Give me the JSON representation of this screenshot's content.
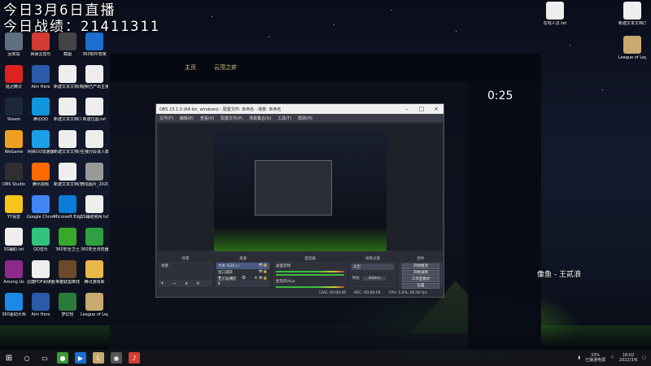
{
  "overlay": {
    "line1": "今日3月6日直播",
    "line2": "今日战绩：21411311",
    "streamer": "像鱼 - 王贰浪"
  },
  "desktop_left": [
    {
      "label": "回收站",
      "icon": "recycle-bin-icon",
      "color": "#607080"
    },
    {
      "label": "网易云音乐",
      "icon": "netease-music-icon",
      "color": "#d43c33"
    },
    {
      "label": "截图",
      "icon": "screenshot-icon",
      "color": "#444"
    },
    {
      "label": "360软件管家",
      "icon": "360-soft-icon",
      "color": "#1a6fd1"
    },
    {
      "label": "延迟精灵",
      "icon": "latency-icon",
      "color": "#d22"
    },
    {
      "label": "Aim Hero",
      "icon": "aim-hero-icon",
      "color": "#2a5aa8"
    },
    {
      "label": "新建文本文档(6).txt",
      "icon": "text-file-icon",
      "color": "#eee"
    },
    {
      "label": "视频已产出主播",
      "icon": "text-file-icon",
      "color": "#eee"
    },
    {
      "label": "Steam",
      "icon": "steam-icon",
      "color": "#1b2838"
    },
    {
      "label": "腾讯QQ",
      "icon": "qq-icon",
      "color": "#1296db"
    },
    {
      "label": "新建文本文档(7).txt",
      "icon": "text-file-icon",
      "color": "#eee"
    },
    {
      "label": "新建位图.txt",
      "icon": "text-file-icon",
      "color": "#eee"
    },
    {
      "label": "WeGame",
      "icon": "wegame-icon",
      "color": "#f0a020"
    },
    {
      "label": "网易UU加速器",
      "icon": "uu-accelerator-icon",
      "color": "#1aa0e8"
    },
    {
      "label": "新建文本文档(4).txt",
      "icon": "text-file-icon",
      "color": "#eee"
    },
    {
      "label": "主播分段录入模板",
      "icon": "text-file-icon",
      "color": "#eee"
    },
    {
      "label": "OBS Studio",
      "icon": "obs-icon",
      "color": "#302e31"
    },
    {
      "label": "腾讯视频",
      "icon": "tencent-video-icon",
      "color": "#ff6a00"
    },
    {
      "label": "新建文本文档(5).txt",
      "icon": "text-file-icon",
      "color": "#eee"
    },
    {
      "label": "微信图片_2020051...",
      "icon": "image-file-icon",
      "color": "#999"
    },
    {
      "label": "YY语音",
      "icon": "yy-icon",
      "color": "#f5c518"
    },
    {
      "label": "Google Chrome",
      "icon": "chrome-icon",
      "color": "#4285f4"
    },
    {
      "label": "Microsoft Edge",
      "icon": "edge-icon",
      "color": "#0a7cd6"
    },
    {
      "label": "SS辅助官网.txt",
      "icon": "text-file-icon",
      "color": "#eee"
    },
    {
      "label": "SS辅助.txt",
      "icon": "text-file-icon",
      "color": "#eee"
    },
    {
      "label": "QQ音乐",
      "icon": "qq-music-icon",
      "color": "#31c27c"
    },
    {
      "label": "360安全卫士",
      "icon": "360-safe-icon",
      "color": "#37a82a"
    },
    {
      "label": "360安全浏览器",
      "icon": "360-browser-icon",
      "color": "#2ea043"
    },
    {
      "label": "Among Us",
      "icon": "rar-icon",
      "color": "#8b2a8b"
    },
    {
      "label": "迅捷PDF阅读器",
      "icon": "text-file-icon",
      "color": "#eee"
    },
    {
      "label": "英雄联盟离线",
      "icon": "archive-icon",
      "color": "#6a4a2a"
    },
    {
      "label": "腾讯游戏库",
      "icon": "folder-icon",
      "color": "#e8b84a"
    },
    {
      "label": "360驱动大师",
      "icon": "driver-icon",
      "color": "#1a8ae6"
    },
    {
      "label": "Aim Hero",
      "icon": "aim-hero-icon",
      "color": "#2a5aa8"
    },
    {
      "label": "梦幻怪",
      "icon": "monster-icon",
      "color": "#2a7a3a"
    },
    {
      "label": "League of Legends",
      "icon": "lol-icon",
      "color": "#c8aa6e"
    }
  ],
  "desktop_right": [
    {
      "label": "在线人员.txt",
      "icon": "text-file-icon",
      "color": "#eee"
    },
    {
      "label": "新建文本文档(3).txt",
      "icon": "text-file-icon",
      "color": "#eee"
    },
    {
      "label": "League of Legends",
      "icon": "lol-icon",
      "color": "#c8aa6e"
    }
  ],
  "client": {
    "tabs": [
      "主页",
      "云顶之弈"
    ],
    "timer": "0:25"
  },
  "obs": {
    "title": "OBS 23.1.0 (64-bit, windows) - 配置文件: 未命名 - 场景: 未命名",
    "menu": [
      "文件(F)",
      "编辑(E)",
      "查看(V)",
      "配置文件(P)",
      "场景集合(S)",
      "工具(T)",
      "帮助(H)"
    ],
    "docks": {
      "scenes_title": "场景",
      "scenes": [
        "场景"
      ],
      "sources_title": "来源",
      "sources": [
        "文本 (GDI+)",
        "窗口捕获",
        "显示器捕获"
      ],
      "mixer_title": "混音器",
      "mixer": [
        "桌面音频",
        "麦克风/Aux"
      ],
      "transitions_title": "场景过渡",
      "transition_value": "淡出",
      "duration_label": "时长",
      "duration_value": "300ms",
      "controls_title": "控件",
      "controls": [
        "开始推流",
        "开始录制",
        "工作室模式",
        "设置",
        "退出"
      ]
    },
    "status": {
      "live": "LIVE: 00:00:00",
      "rec": "REC: 00:00:00",
      "cpu": "CPU: 5.6%, 60.00 fps"
    }
  },
  "taskbar": {
    "battery": "33%",
    "battery_state": "已接通电源",
    "time": "18:02",
    "date": "2022/3/6"
  }
}
